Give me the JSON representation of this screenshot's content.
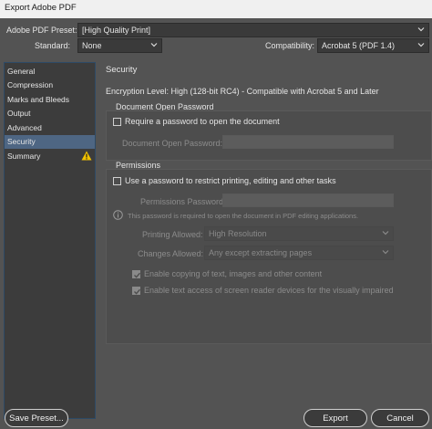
{
  "window": {
    "title": "Export Adobe PDF"
  },
  "top": {
    "preset_label": "Adobe PDF Preset:",
    "preset_value": "[High Quality Print]",
    "standard_label": "Standard:",
    "standard_value": "None",
    "compat_label": "Compatibility:",
    "compat_value": "Acrobat 5 (PDF 1.4)"
  },
  "sidebar": {
    "items": [
      {
        "label": "General"
      },
      {
        "label": "Compression"
      },
      {
        "label": "Marks and Bleeds"
      },
      {
        "label": "Output"
      },
      {
        "label": "Advanced"
      },
      {
        "label": "Security"
      },
      {
        "label": "Summary"
      }
    ],
    "active_index": 5
  },
  "main": {
    "section_title": "Security",
    "encryption_text": "Encryption Level: High (128-bit RC4) - Compatible with Acrobat 5 and Later",
    "open_group": {
      "title": "Document Open Password",
      "require_checkbox": "Require a password to open the document",
      "password_label": "Document Open Password:"
    },
    "perm_group": {
      "title": "Permissions",
      "use_checkbox": "Use a password to restrict printing, editing and other tasks",
      "password_label": "Permissions Password:",
      "info_text": "This password is required to open the document in PDF editing applications.",
      "printing_label": "Printing Allowed:",
      "printing_value": "High Resolution",
      "changes_label": "Changes Allowed:",
      "changes_value": "Any except extracting pages",
      "copy_checkbox": "Enable copying of text, images and other content",
      "access_checkbox": "Enable text access of screen reader devices for the visually impaired"
    }
  },
  "footer": {
    "save_preset": "Save Preset...",
    "export": "Export",
    "cancel": "Cancel"
  }
}
